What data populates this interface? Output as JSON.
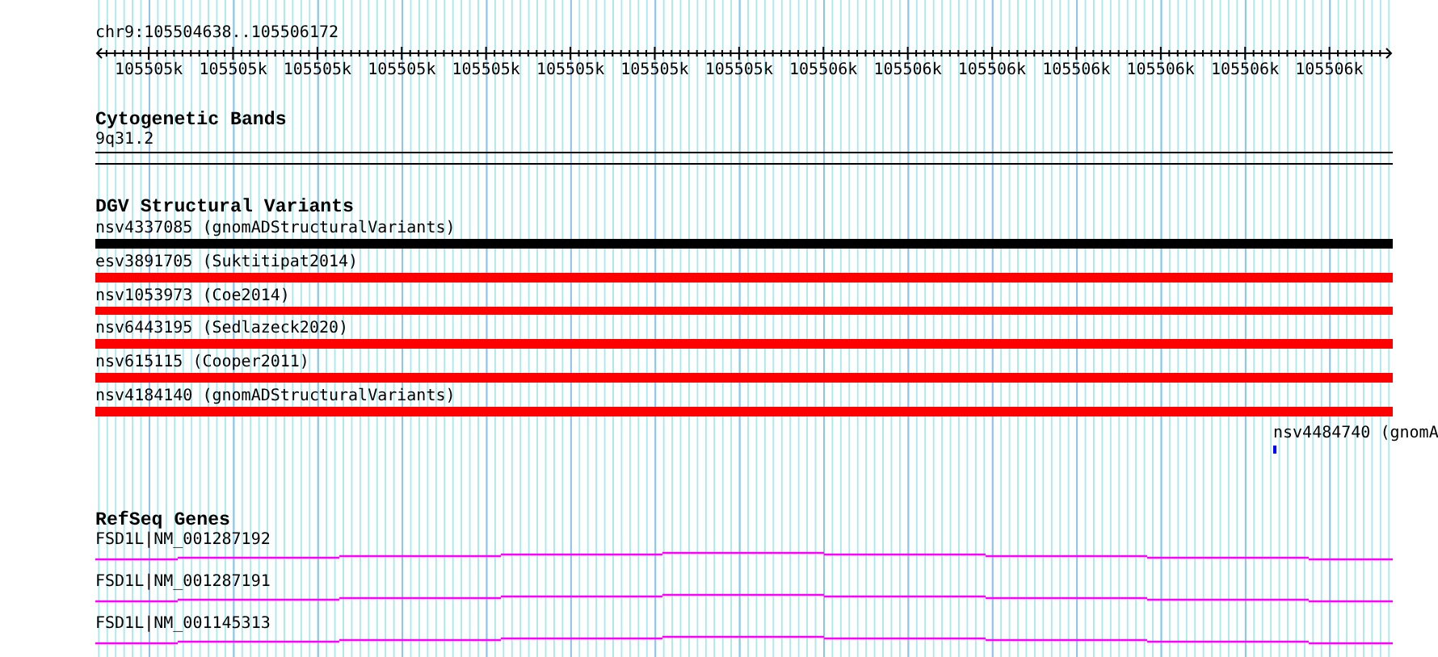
{
  "location": "chr9:105504638..105506172",
  "ruler_labels": [
    "105505k",
    "105505k",
    "105505k",
    "105505k",
    "105505k",
    "105505k",
    "105505k",
    "105505k",
    "105506k",
    "105506k",
    "105506k",
    "105506k",
    "105506k",
    "105506k",
    "105506k"
  ],
  "cytogenetic_bands": {
    "title": "Cytogenetic Bands",
    "band": "9q31.2"
  },
  "dgv_structural_variants": {
    "title": "DGV Structural Variants",
    "items": [
      {
        "kind": "full",
        "label": "nsv4337085 (gnomADStructuralVariants)",
        "color": "#000000"
      },
      {
        "kind": "full",
        "label": "esv3891705 (Suktitipat2014)",
        "color": "#ff0000"
      },
      {
        "kind": "full",
        "label": "nsv1053973 (Coe2014)",
        "color": "#ff0000"
      },
      {
        "kind": "full",
        "label": "nsv6443195 (Sedlazeck2020)",
        "color": "#ff0000"
      },
      {
        "kind": "full",
        "label": "nsv615115 (Cooper2011)",
        "color": "#ff0000"
      },
      {
        "kind": "full",
        "label": "nsv4184140 (gnomADStructuralVariants)",
        "color": "#ff0000"
      },
      {
        "kind": "point",
        "label": "nsv4484740 (gnomA",
        "color": "#0000ff"
      }
    ]
  },
  "refseq_genes": {
    "title": "RefSeq Genes",
    "items": [
      {
        "label": "FSD1L|NM_001287192"
      },
      {
        "label": "FSD1L|NM_001287191"
      },
      {
        "label": "FSD1L|NM_001145313"
      }
    ]
  }
}
